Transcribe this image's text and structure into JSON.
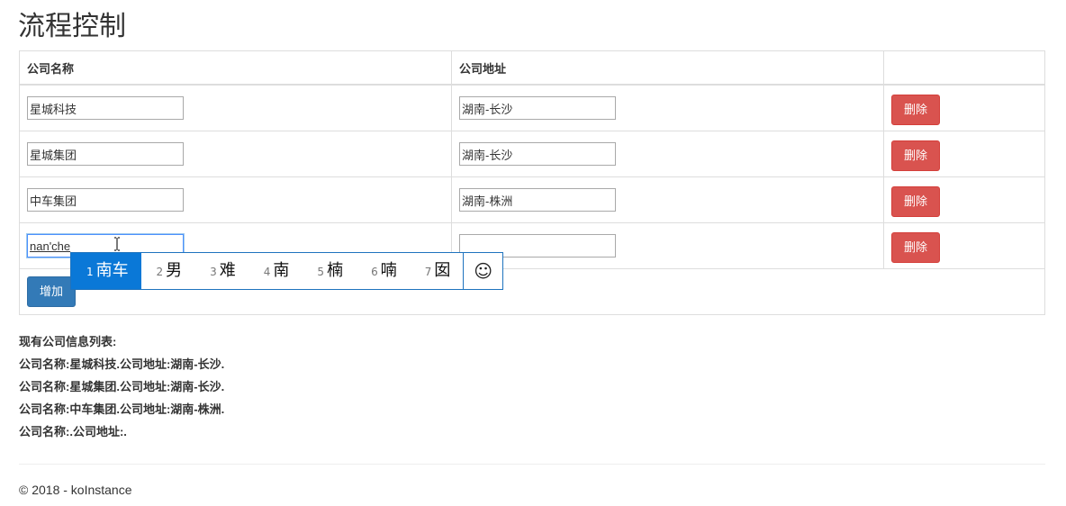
{
  "page": {
    "title": "流程控制"
  },
  "table": {
    "headers": {
      "name": "公司名称",
      "address": "公司地址",
      "action": ""
    },
    "rows": [
      {
        "name": "星城科技",
        "address": "湖南-长沙",
        "delete_label": "删除"
      },
      {
        "name": "星城集团",
        "address": "湖南-长沙",
        "delete_label": "删除"
      },
      {
        "name": "中车集团",
        "address": "湖南-株洲",
        "delete_label": "删除"
      },
      {
        "name": "nan'che",
        "address": "",
        "delete_label": "删除"
      }
    ],
    "add_label": "增加"
  },
  "ime": {
    "candidates": [
      {
        "num": "1",
        "text": "南车"
      },
      {
        "num": "2",
        "text": "男"
      },
      {
        "num": "3",
        "text": "难"
      },
      {
        "num": "4",
        "text": "南"
      },
      {
        "num": "5",
        "text": "楠"
      },
      {
        "num": "6",
        "text": "喃"
      },
      {
        "num": "7",
        "text": "囡"
      }
    ],
    "emoji": "☺"
  },
  "summary": {
    "heading": "现有公司信息列表:",
    "lines": [
      "公司名称:星城科技.公司地址:湖南-长沙.",
      "公司名称:星城集团.公司地址:湖南-长沙.",
      "公司名称:中车集团.公司地址:湖南-株洲.",
      "公司名称:.公司地址:."
    ]
  },
  "footer": {
    "text": "© 2018 - koInstance"
  },
  "colors": {
    "danger": "#d9534f",
    "primary": "#337ab7",
    "ime_selected": "#0a78d7"
  }
}
